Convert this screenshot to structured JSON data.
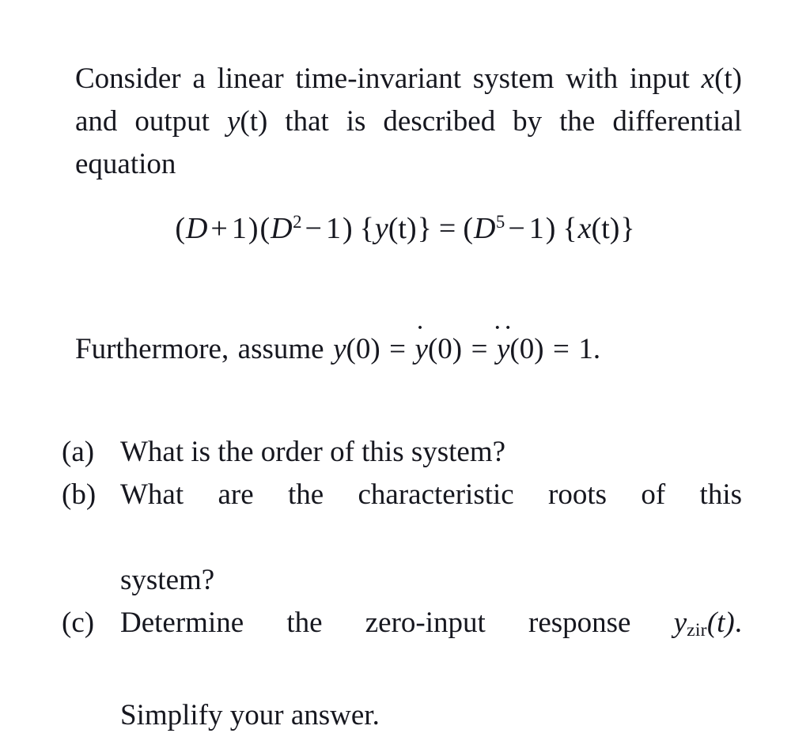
{
  "document": {
    "background_color": "#ffffff",
    "text_color": "#16171f",
    "intro": {
      "seg1": "Consider a linear time-invariant system with input ",
      "var_x": "x",
      "paren_t_1": "(t)",
      "seg2": " and output ",
      "var_y": "y",
      "paren_t_2": "(t)",
      "seg3": " that is described by the differential equation"
    },
    "equation": {
      "full_text": "(D+1)(D^2 - 1){y(t)} = (D^5 - 1){x(t)}",
      "lhs_open": "(",
      "lhs_D1": "D",
      "lhs_plus": "+",
      "lhs_one": "1",
      "lhs_close": ")",
      "lhs2_open": "(",
      "lhs2_D": "D",
      "lhs2_exp": "2",
      "lhs2_minus": "−",
      "lhs2_one": "1",
      "lhs2_close": ")",
      "lhs_brace_open": "{",
      "lhs_y": "y",
      "lhs_yt": "(t)",
      "lhs_brace_close": "}",
      "equals": "=",
      "rhs_open": "(",
      "rhs_D": "D",
      "rhs_exp": "5",
      "rhs_minus": "−",
      "rhs_one": "1",
      "rhs_close": ")",
      "rhs_brace_open": "{",
      "rhs_x": "x",
      "rhs_xt": "(t)",
      "rhs_brace_close": "}"
    },
    "assume": {
      "seg1": "Furthermore, assume ",
      "y0_var": "y",
      "y0_arg": "(0)",
      "eq1": "=",
      "ydot_var": "y",
      "ydot_accent": "·",
      "ydot_arg": "(0)",
      "eq2": "=",
      "yddot_var": "y",
      "yddot_accent": "··",
      "yddot_arg": "(0)",
      "tail_equals": "=",
      "tail_value": "1."
    },
    "questions": [
      {
        "marker": "(a)",
        "line1": "What is the order of this system?",
        "line2": "",
        "has_math": false
      },
      {
        "marker": "(b)",
        "line1": "What are the characteristic roots of this",
        "line2": "system?",
        "has_math": false
      },
      {
        "marker": "(c)",
        "line1_prefix": "Determine the zero-input response ",
        "math_var": "y",
        "math_sub": "zir",
        "math_arg": "(t)",
        "line1_suffix": ".",
        "line2": "Simplify your answer.",
        "has_math": true
      }
    ]
  }
}
